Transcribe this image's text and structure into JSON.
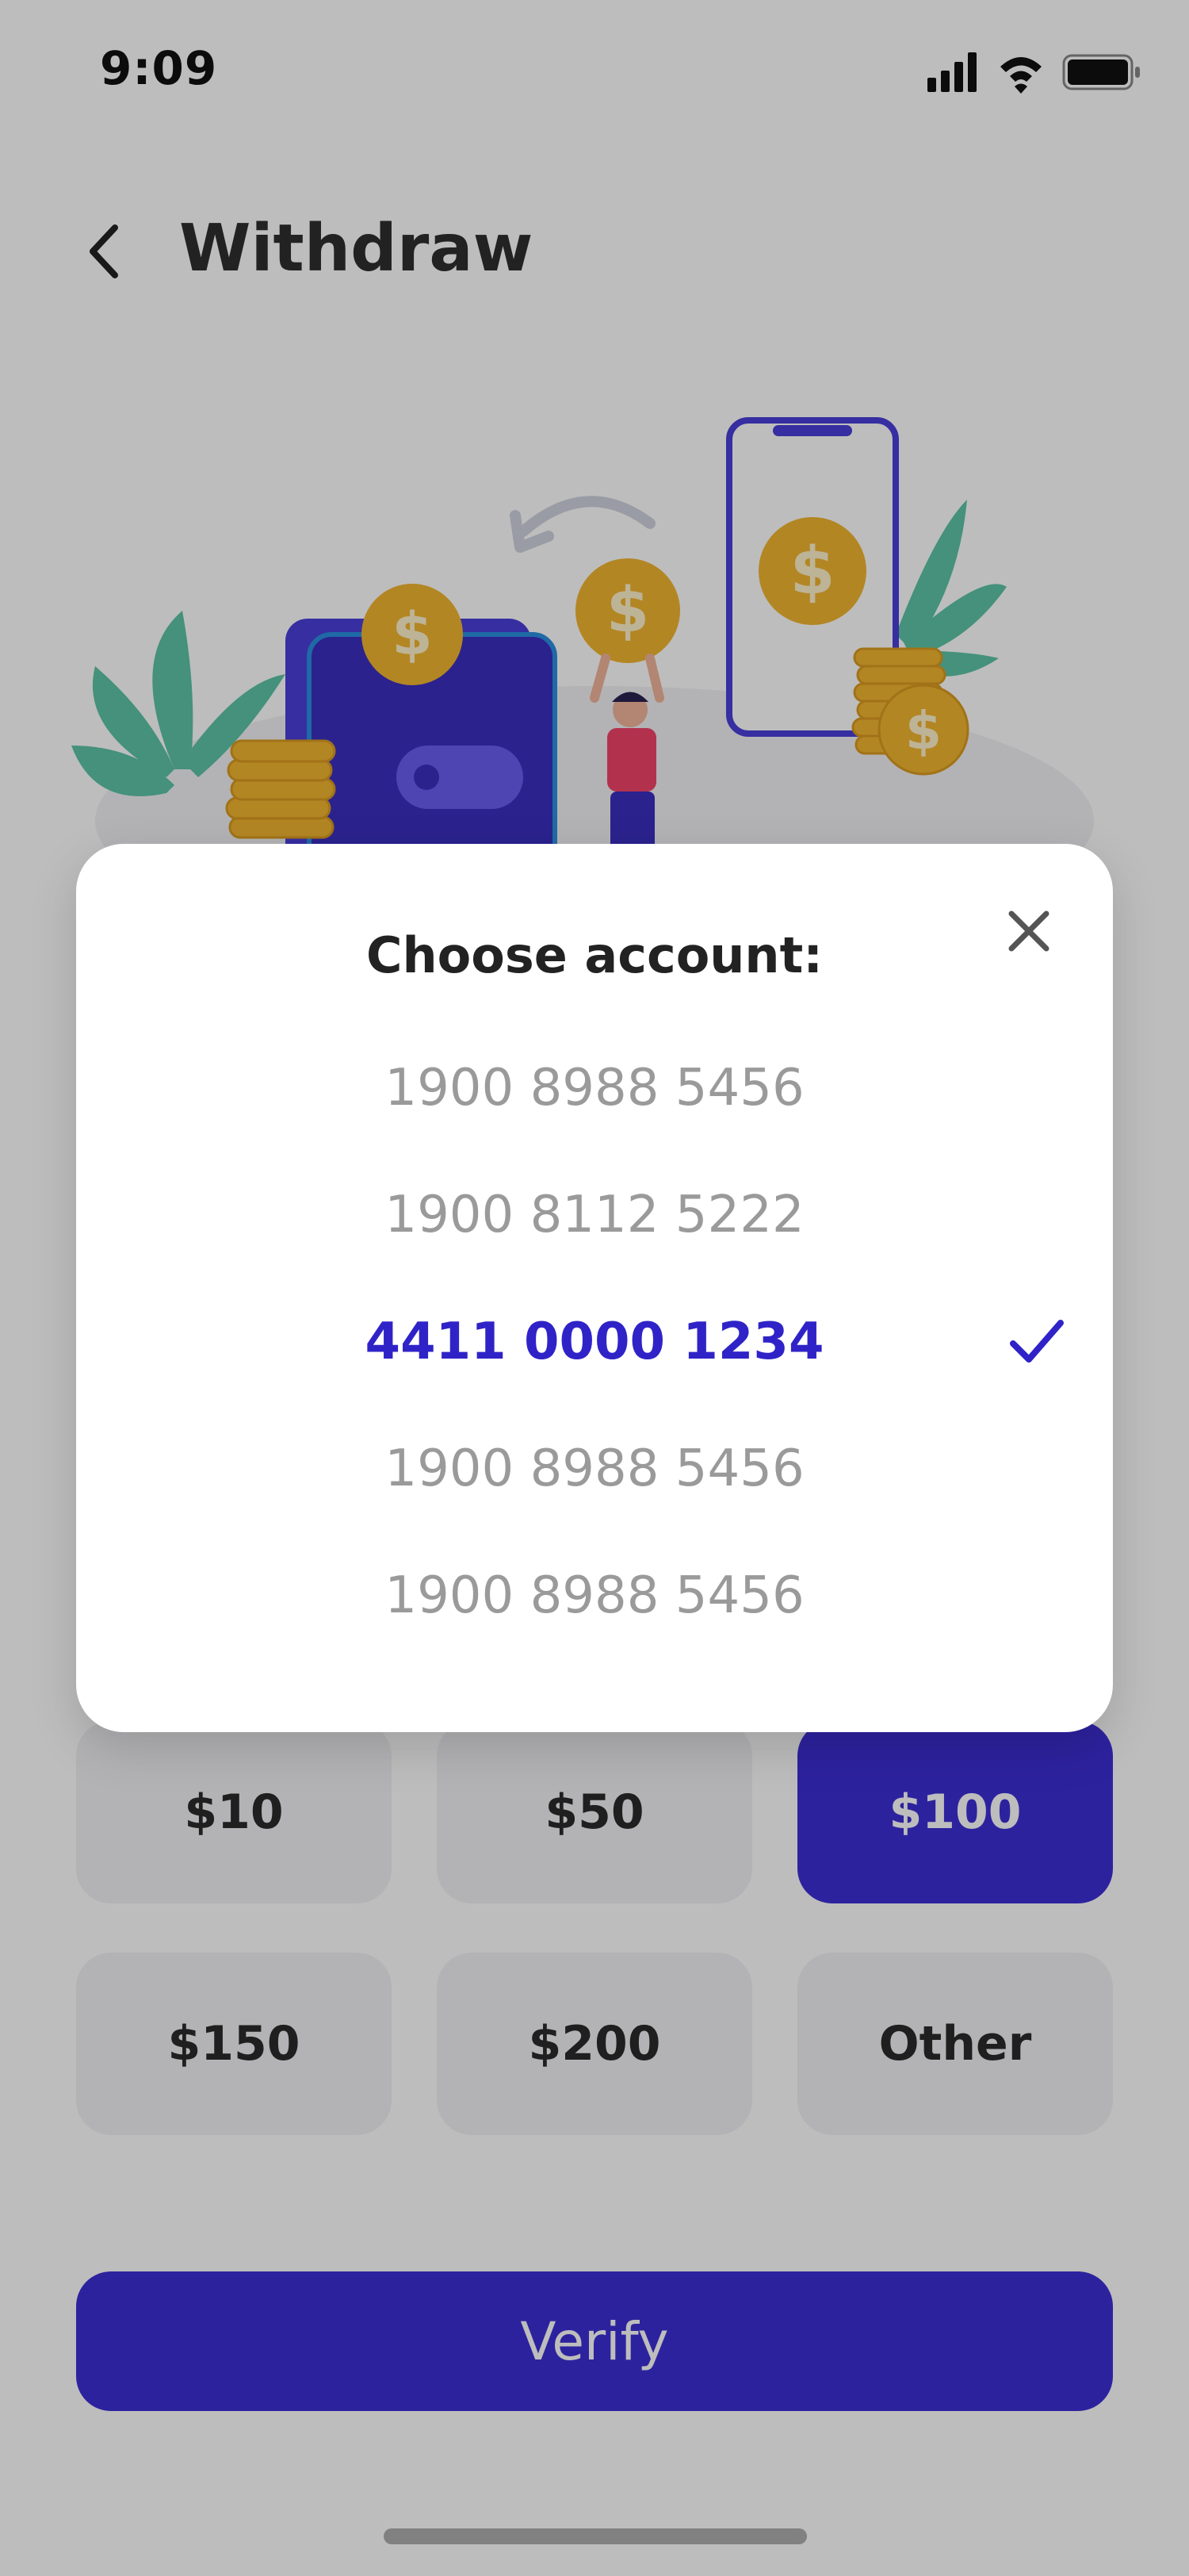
{
  "status_bar": {
    "time": "9:09"
  },
  "header": {
    "title": "Withdraw"
  },
  "modal": {
    "title": "Choose account:",
    "accounts": [
      {
        "number": "1900 8988 5456",
        "selected": false
      },
      {
        "number": "1900 8112 5222",
        "selected": false
      },
      {
        "number": "4411 0000 1234",
        "selected": true
      },
      {
        "number": "1900 8988 5456",
        "selected": false
      },
      {
        "number": "1900 8988 5456",
        "selected": false
      }
    ]
  },
  "amounts": [
    {
      "label": "$10",
      "selected": false
    },
    {
      "label": "$50",
      "selected": false
    },
    {
      "label": "$100",
      "selected": true
    },
    {
      "label": "$150",
      "selected": false
    },
    {
      "label": "$200",
      "selected": false
    },
    {
      "label": "Other",
      "selected": false
    }
  ],
  "verify": {
    "label": "Verify"
  },
  "colors": {
    "accent": "#3d2fd6",
    "selected_text": "#2f23c8",
    "coin": "#f2b531",
    "leaf": "#5ec4a6",
    "wallet": "#4a3fd9",
    "overlay": "rgba(0,0,0,0.26)"
  },
  "icons": {
    "back": "chevron-left-icon",
    "close": "close-icon",
    "check": "checkmark-icon",
    "signal": "signal-icon",
    "wifi": "wifi-icon",
    "battery": "battery-icon"
  }
}
